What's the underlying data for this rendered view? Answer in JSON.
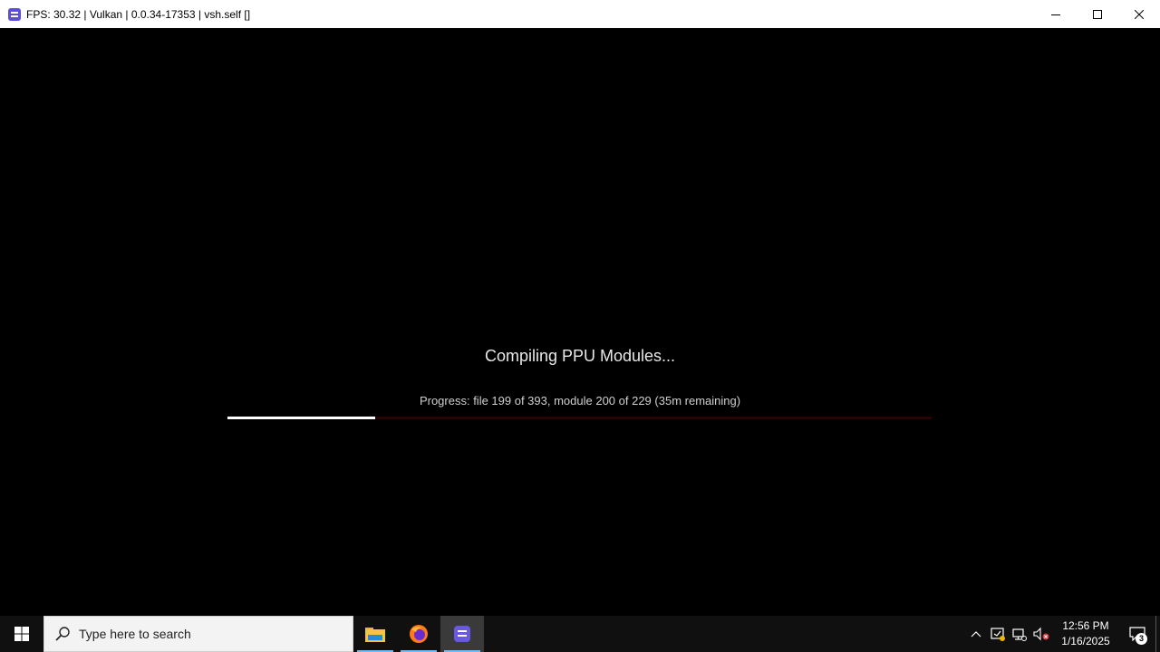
{
  "window": {
    "title": "FPS: 30.32 | Vulkan | 0.0.34-17353 | vsh.self []",
    "accent": "#5b4fd6"
  },
  "compile": {
    "heading": "Compiling PPU Modules...",
    "progress_text": "Progress: file 199 of 393, module 200 of 229 (35m remaining)",
    "progress_fraction": 0.21,
    "bar_color": "#ffffff",
    "track_color": "#2a0306"
  },
  "taskbar": {
    "search_placeholder": "Type here to search",
    "apps": [
      "file-explorer",
      "firefox",
      "rpcs3"
    ],
    "clock_time": "12:56 PM",
    "clock_date": "1/16/2025",
    "notification_count": "3"
  }
}
